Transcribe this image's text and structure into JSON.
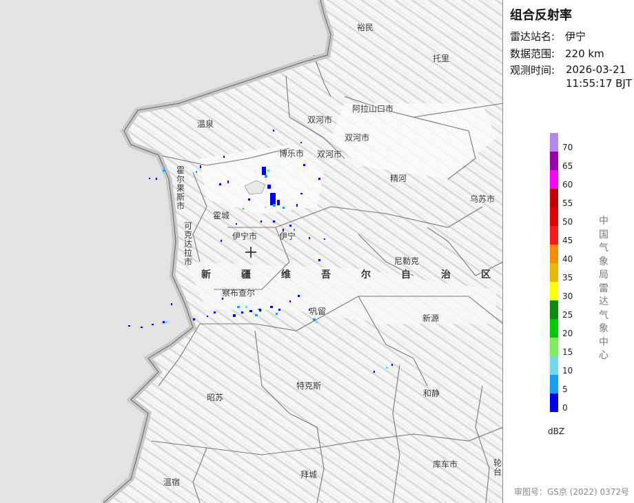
{
  "panel": {
    "title": "组合反射率",
    "station_key": "雷达站名:",
    "station_val": "伊宁",
    "range_key": "数据范围:",
    "range_val": "220 km",
    "time_key": "观测时间:",
    "time_date": "2026-03-21",
    "time_clock": "11:55:17 BJT",
    "unit": "dBZ",
    "vendor": "中国气象局雷达气象中心",
    "footer": "审图号：GS京 (2022) 0372号"
  },
  "legend": {
    "colors": [
      "#b38aec",
      "#9a00aa",
      "#ff00ff",
      "#c00000",
      "#e00000",
      "#ff1a1a",
      "#ff8c00",
      "#e6b800",
      "#ffff00",
      "#0c8b0c",
      "#00c800",
      "#7cef5a",
      "#6edcee",
      "#18a0f0",
      "#0000f6"
    ],
    "labels": [
      "70",
      "65",
      "60",
      "55",
      "50",
      "45",
      "40",
      "35",
      "30",
      "25",
      "20",
      "15",
      "10",
      "5",
      "0"
    ]
  },
  "map": {
    "places": {
      "yumin": "裕民",
      "tuoli": "托里",
      "alashankou": "阿拉山口市",
      "wenquan": "温泉",
      "shuanghe1": "双河市",
      "shuanghe2": "双河市",
      "shuanghe3": "双河市",
      "bole": "博乐市",
      "jinghe": "精河",
      "wusu": "乌苏市",
      "huocheng": "霍城",
      "yiningshi": "伊宁市",
      "yining": "伊宁",
      "nileke": "尼勒克",
      "chabuchaer": "察布查尔",
      "gongliu": "巩留",
      "xinyuan": "新源",
      "zhaosu": "昭苏",
      "tekesi": "特克斯",
      "hejing": "和静",
      "wensu": "温宿",
      "baicheng": "拜城",
      "kuche": "库车市",
      "luntai": "轮台",
      "horgos": "霍尔果斯市",
      "kokdala": "可克达拉市"
    },
    "region_chars": [
      "新",
      "疆",
      "维",
      "吾",
      "尔",
      "自",
      "治",
      "区"
    ]
  }
}
